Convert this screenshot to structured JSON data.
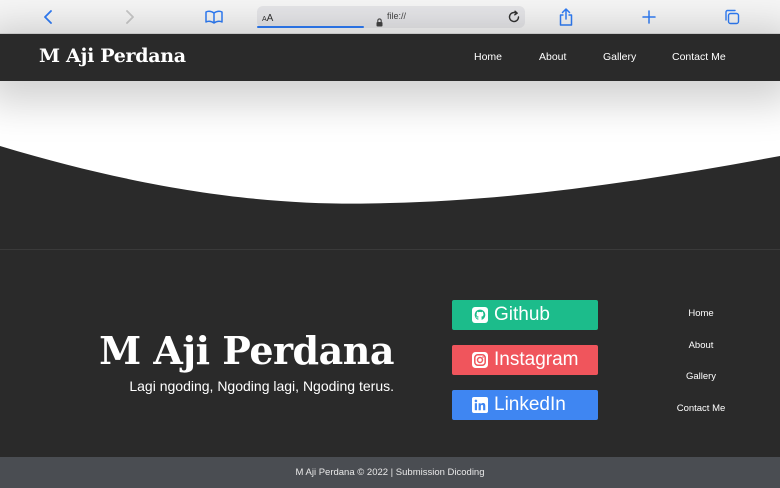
{
  "browser": {
    "aa_small": "A",
    "aa_big": "A",
    "url": "file://"
  },
  "site": {
    "brand": "M Aji Perdana",
    "nav": [
      "Home",
      "About",
      "Gallery",
      "Contact Me"
    ]
  },
  "footer": {
    "title": "M Aji Perdana",
    "tagline": "Lagi ngoding, Ngoding lagi, Ngoding terus.",
    "social": [
      {
        "label": "Github",
        "icon": "github-icon",
        "color": "#1cbc8b"
      },
      {
        "label": "Instagram",
        "icon": "instagram-icon",
        "color": "#f0555c"
      },
      {
        "label": "LinkedIn",
        "icon": "linkedin-icon",
        "color": "#3f86f2"
      }
    ],
    "nav": [
      "Home",
      "About",
      "Gallery",
      "Contact Me"
    ],
    "copyright": "M Aji Perdana © 2022 | Submission Dicoding"
  },
  "colors": {
    "nav_bg": "#2a2a2a",
    "footer_bottom_bg": "#4a4d52",
    "accent": "#2f7cf6"
  }
}
